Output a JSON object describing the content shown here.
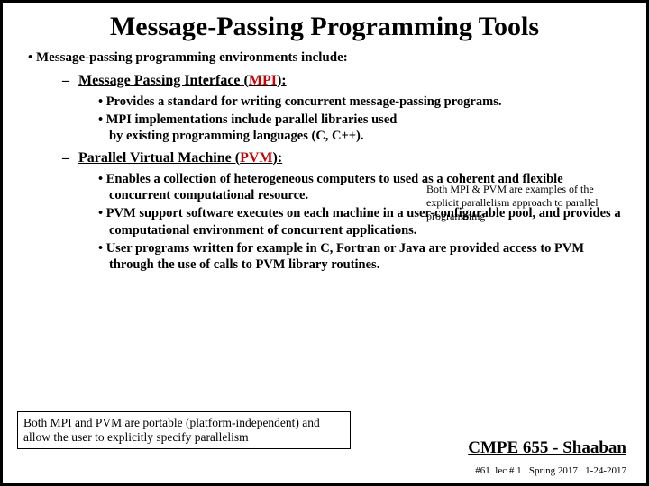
{
  "title": "Message-Passing Programming Tools",
  "intro": "Message-passing programming environments include:",
  "section1": {
    "heading_prefix": "Message Passing Interface (",
    "heading_accent": "MPI",
    "heading_suffix": "):",
    "bullets": [
      "Provides a standard  for writing concurrent message-passing programs.",
      "MPI implementations include parallel libraries used by existing programming languages (C, C++)."
    ]
  },
  "aside": "Both MPI & PVM are examples of the explicit parallelism approach to parallel programming",
  "section2": {
    "heading_prefix": "Parallel Virtual Machine (",
    "heading_accent": "PVM",
    "heading_suffix": "):",
    "bullets": [
      "Enables a collection of heterogeneous computers to used as a coherent and flexible concurrent computational resource.",
      "PVM support software executes on each machine in a user-configurable pool, and provides a computational environment of concurrent applications.",
      "User programs written for example in C, Fortran or Java are provided access to PVM through the use of calls to PVM library routines."
    ]
  },
  "note": "Both MPI and PVM are portable (platform-independent) and allow the user to explicitly specify parallelism",
  "footer": {
    "brand": "CMPE 655 - Shaaban",
    "small": "#61  lec # 1   Spring 2017   1-24-2017"
  }
}
